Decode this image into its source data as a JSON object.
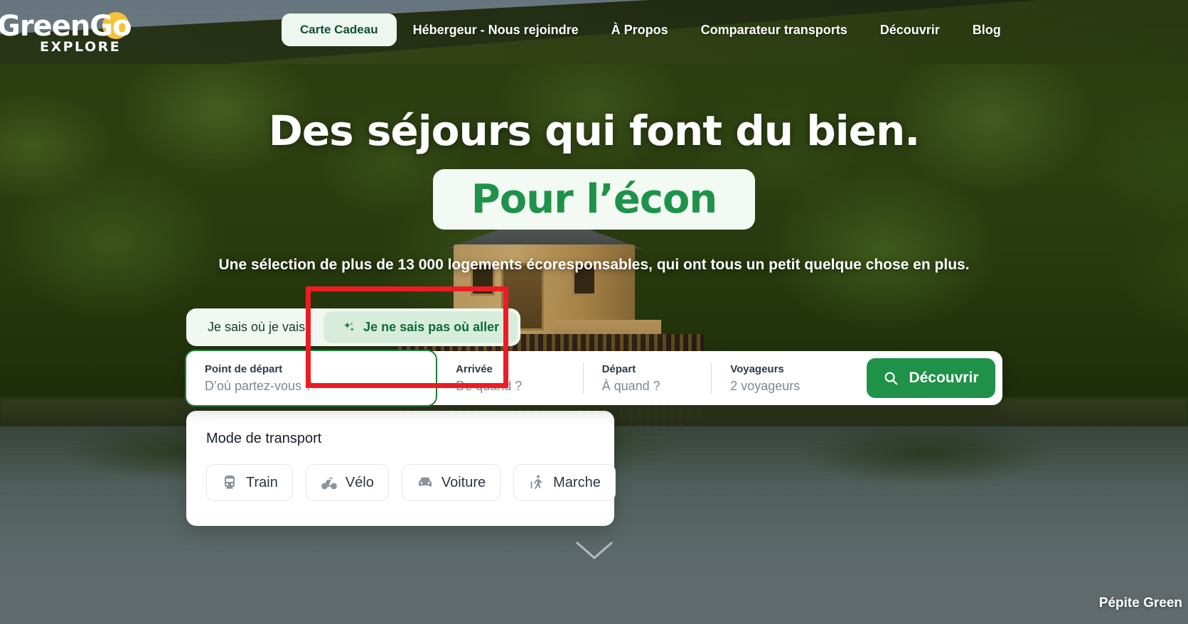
{
  "brand": {
    "logo_word": "GreenGo",
    "logo_sub": "EXPLORE",
    "accent_yellow": "#f5c33b",
    "accent_green": "#1f9149",
    "dark_green": "#0f5132"
  },
  "nav": {
    "gift_card_label": "Carte Cadeau",
    "links": [
      {
        "label": "Hébergeur - Nous rejoindre"
      },
      {
        "label": "À Propos"
      },
      {
        "label": "Comparateur transports"
      },
      {
        "label": "Découvrir"
      },
      {
        "label": "Blog"
      }
    ]
  },
  "hero": {
    "title": "Des séjours qui font du bien.",
    "highlight": "Pour l’écon",
    "subtitle": "Une sélection de plus de 13 000 logements écoresponsables, qui ont tous un petit quelque chose en plus."
  },
  "search": {
    "tabs": [
      {
        "label": "Je sais où je vais",
        "active": false,
        "icon": ""
      },
      {
        "label": "Je ne sais pas où aller",
        "active": true,
        "icon": "sparkle-icon"
      }
    ],
    "fields": [
      {
        "label": "Point de départ",
        "value": "D’où partez-vous ?",
        "focused": true
      },
      {
        "label": "Arrivée",
        "value": "De quand ?",
        "focused": false
      },
      {
        "label": "Départ",
        "value": "À quand ?",
        "focused": false
      },
      {
        "label": "Voyageurs",
        "value": "2 voyageurs",
        "focused": false
      }
    ],
    "cta_label": "Découvrir",
    "cta_icon": "search-icon"
  },
  "transport_panel": {
    "title": "Mode de transport",
    "options": [
      {
        "label": "Train",
        "icon": "train-icon"
      },
      {
        "label": "Vélo",
        "icon": "bicycle-icon"
      },
      {
        "label": "Voiture",
        "icon": "car-icon"
      },
      {
        "label": "Marche",
        "icon": "walking-icon"
      }
    ]
  },
  "annotation": {
    "color": "#ee1c22"
  },
  "footer_badge": {
    "label": "Pépite Green"
  }
}
